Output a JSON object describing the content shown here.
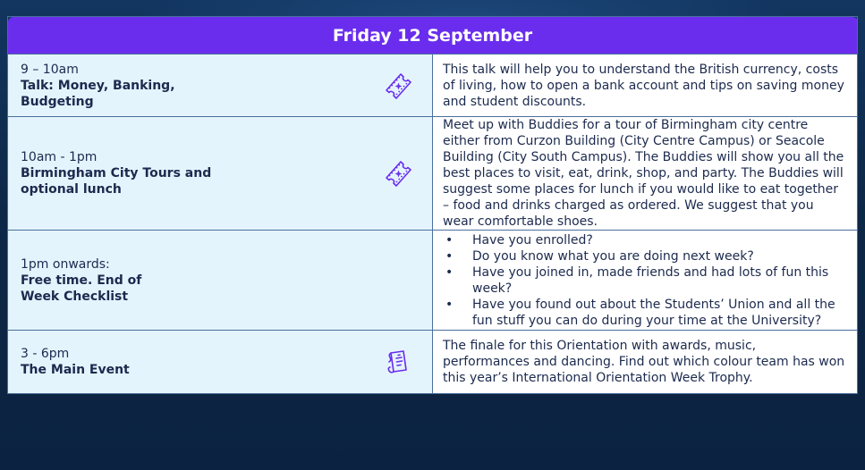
{
  "header": {
    "title": "Friday 12 September"
  },
  "events": [
    {
      "time": "9 – 10am",
      "title": "Talk: Money, Banking, Budgeting",
      "icon": "ticket-icon",
      "description": "This talk will help you to understand the British currency, costs of living, how to open a bank account and tips on saving money and student discounts."
    },
    {
      "time": "10am - 1pm",
      "title": "Birmingham City Tours and optional lunch",
      "icon": "ticket-icon",
      "description": "Meet up with Buddies for a tour of Birmingham city centre either from Curzon Building (City Centre Campus) or Seacole Building (City South Campus). The Buddies will show you all the best places to visit, eat, drink, shop, and party. The Buddies will suggest some places for lunch if you would like to eat together – food and drinks charged as ordered. We suggest that you wear comfortable shoes."
    },
    {
      "time": "1pm onwards:",
      "title": "Free time. End of Week Checklist",
      "checklist": [
        "Have you enrolled?",
        "Do you know what you are doing next week?",
        "Have you joined in, made friends and had lots of fun this week?",
        "Have you found out about the Students’ Union and all the fun stuff you can do during your time at the University?"
      ]
    },
    {
      "time": "3 - 6pm",
      "title": "The Main Event",
      "icon": "flyer-icon",
      "description": "The finale for this Orientation with awards, music, performances and dancing. Find out which colour team has won this year’s International Orientation Week Trophy."
    }
  ]
}
